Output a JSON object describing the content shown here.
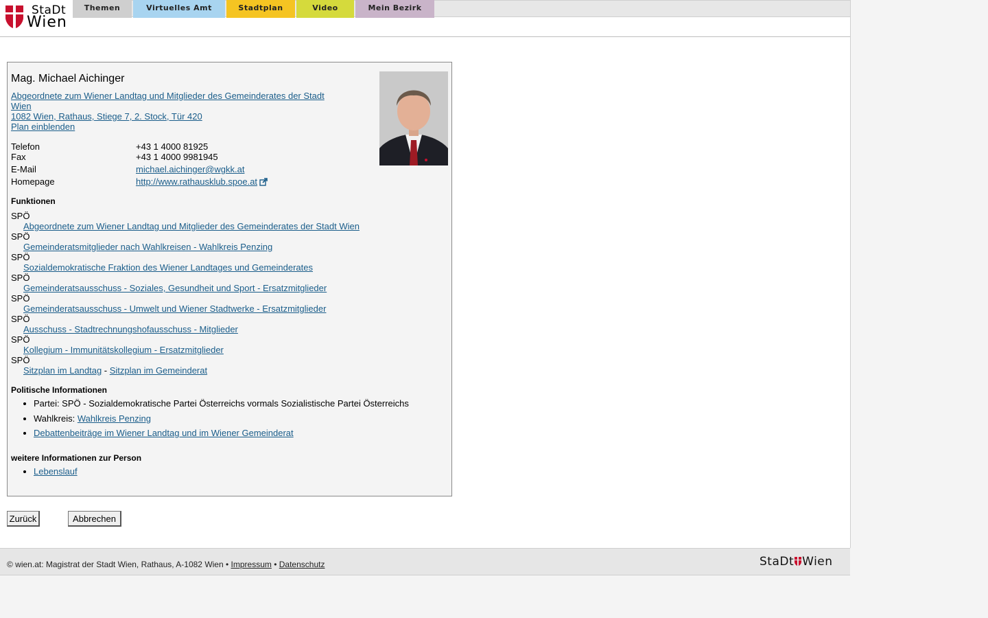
{
  "logo": {
    "line1": "StaDt",
    "line2": "Wien"
  },
  "tabs": [
    {
      "label": "Themen"
    },
    {
      "label": "Virtuelles Amt"
    },
    {
      "label": "Stadtplan"
    },
    {
      "label": "Video"
    },
    {
      "label": "Mein Bezirk"
    }
  ],
  "person": {
    "name": "Mag. Michael Aichinger",
    "role_link_line1": "Abgeordnete zum Wiener Landtag und Mitglieder des Gemeinderates der Stadt",
    "role_link_line2": "Wien",
    "address": "1082 Wien, Rathaus, Stiege 7, 2. Stock, Tür 420",
    "plan_link": "Plan einblenden",
    "contacts": [
      {
        "label": "Telefon",
        "value": "+43 1 4000 81925"
      },
      {
        "label": "Fax",
        "value": "+43 1 4000 9981945"
      },
      {
        "label": "E-Mail",
        "value": "michael.aichinger@wgkk.at"
      },
      {
        "label": "Homepage",
        "value": "http://www.rathausklub.spoe.at"
      }
    ]
  },
  "functions": {
    "heading": "Funktionen",
    "items": [
      {
        "party": "SPÖ",
        "link": "Abgeordnete zum Wiener Landtag und Mitglieder des Gemeinderates der Stadt Wien"
      },
      {
        "party": "SPÖ",
        "link": "Gemeinderatsmitglieder nach Wahlkreisen - Wahlkreis Penzing"
      },
      {
        "party": "SPÖ",
        "link": "Sozialdemokratische Fraktion des Wiener Landtages und Gemeinderates"
      },
      {
        "party": "SPÖ",
        "link": "Gemeinderatsausschuss - Soziales, Gesundheit und Sport - Ersatzmitglieder"
      },
      {
        "party": "SPÖ",
        "link": "Gemeinderatsausschuss - Umwelt und Wiener Stadtwerke - Ersatzmitglieder"
      },
      {
        "party": "SPÖ",
        "link": "Ausschuss - Stadtrechnungshofausschuss - Mitglieder"
      },
      {
        "party": "SPÖ",
        "link": "Kollegium - Immunitätskollegium - Ersatzmitglieder"
      }
    ],
    "last_party": "SPÖ",
    "seat_landtag": "Sitzplan im Landtag",
    "seat_separator": " - ",
    "seat_gemeinderat": "Sitzplan im Gemeinderat"
  },
  "political": {
    "heading": "Politische Informationen",
    "party_label": "Partei: SPÖ - Sozialdemokratische Partei Österreichs vormals Sozialistische Partei Österreichs",
    "wahlkreis_label": "Wahlkreis: ",
    "wahlkreis_link": "Wahlkreis Penzing",
    "debatten_link": "Debattenbeiträge im Wiener Landtag und im Wiener Gemeinderat"
  },
  "more": {
    "heading": "weitere Informationen zur Person",
    "lebenslauf": "Lebenslauf"
  },
  "buttons": {
    "back": "Zurück",
    "cancel": "Abbrechen"
  },
  "footer": {
    "copyright": "© wien.at: Magistrat der Stadt Wien, Rathaus, A-1082 Wien",
    "bullet": " • ",
    "impressum": "Impressum",
    "datenschutz": "Datenschutz",
    "logo_left": "StaDt",
    "logo_right": "Wien"
  },
  "colors": {
    "link": "#1a5d8a",
    "tab_themen": "#cfcfcf",
    "tab_amt": "#a8d4f0",
    "tab_stadtplan": "#f5c422",
    "tab_video": "#d5da3c",
    "tab_bezirk": "#c9b4c9",
    "brand_red": "#c8102e"
  }
}
